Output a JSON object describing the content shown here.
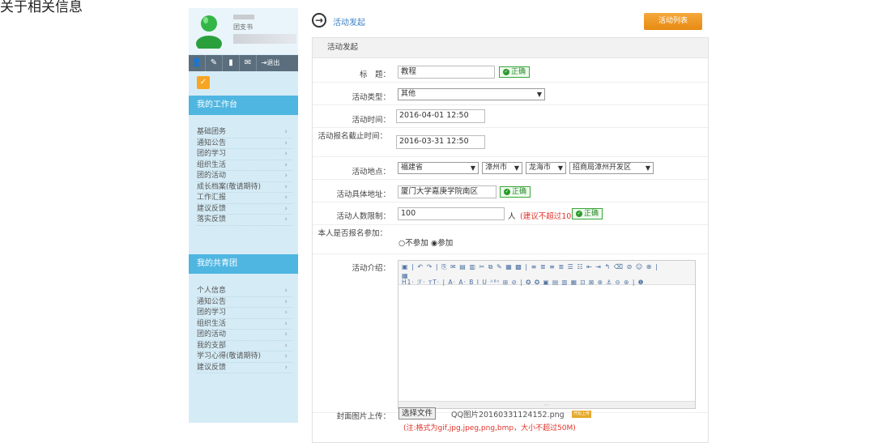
{
  "top_text": "关于相关信息",
  "profile": {
    "name": "团支书"
  },
  "toolbar": {
    "icons": [
      "user-icon",
      "wrench-icon",
      "doc-icon",
      "mail-icon",
      "exit-icon"
    ],
    "exit_label": "退出"
  },
  "workbench": {
    "title": "我的工作台",
    "items": [
      "基础团务",
      "通知公告",
      "团的学习",
      "组织生活",
      "团的活动",
      "成长档案(敬请期待)",
      "工作汇报",
      "建议反馈",
      "落实反馈"
    ]
  },
  "league": {
    "title": "我的共青团",
    "items": [
      "个人信息",
      "通知公告",
      "团的学习",
      "组织生活",
      "团的活动",
      "我的支部",
      "学习心得(敬请期待)",
      "建议反馈"
    ]
  },
  "header": {
    "breadcrumb": "活动发起",
    "list_button": "活动列表"
  },
  "form": {
    "panel_title": "活动发起",
    "title_label": "标　题：",
    "title_value": "教程",
    "ok_label": "正确",
    "type_label": "活动类型：",
    "type_value": "其他",
    "time_label": "活动时间：",
    "time_value": "2016-04-01 12:50",
    "deadline_label": "活动报名截止时间：",
    "deadline_value": "2016-03-31 12:50",
    "location_label": "活动地点：",
    "province": "福建省",
    "city": "漳州市",
    "district": "龙海市",
    "zone": "招商局漳州开发区",
    "address_label": "活动具体地址：",
    "address_value": "厦门大学嘉庚学院南区",
    "limit_label": "活动人数限制：",
    "limit_value": "100",
    "limit_unit": "人",
    "limit_hint": "(建议不超过100人)",
    "join_label": "本人是否报名参加：",
    "join_no": "不参加",
    "join_yes": "参加",
    "intro_label": "活动介绍：",
    "editor_toolbar_1": "▣ | ↶ ↷ | ⎘ ✉ ▤ ▥ ✂ ⧉ ✎ ▦ ▩ | ≡ ≣ ≡ ≣ ☰ ☷ ⇤ ⇥ ↰ ⌫ ⊘ ☺ ⊕ |",
    "editor_toolbar_2": "▦",
    "editor_toolbar_3": "H1· ℱ· ᴛT· | A· A· B I U ᴬᴮᶜ ⊞ ⊘ | ✪ ✪ ▣ ▤ ▥ ▦ ⊡ ⊠ ⊗ ⚓ ⊝ ⊛ | ❶",
    "cover_label": "封面图片上传：",
    "file_button": "选择文件",
    "file_name": "QQ图片20160331124152.png",
    "upload_label": "开始上传",
    "cover_note": "(注:格式为gif,jpg,jpeg,png,bmp，大小不超过50M)"
  }
}
